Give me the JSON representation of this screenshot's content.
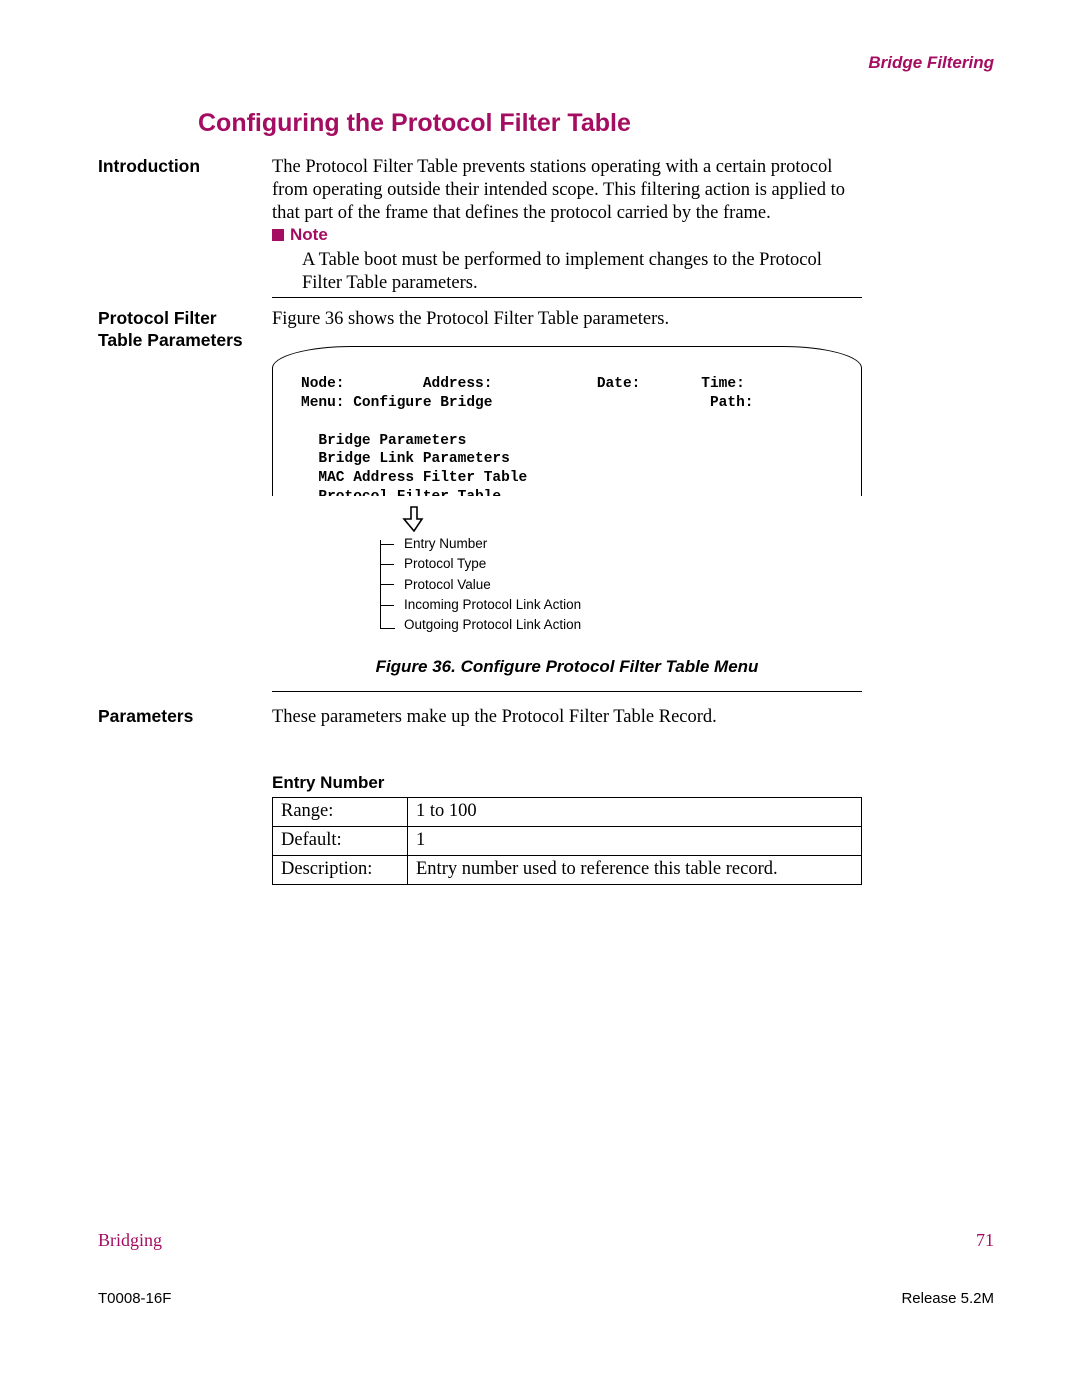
{
  "header": {
    "section": "Bridge Filtering"
  },
  "title": "Configuring the Protocol Filter Table",
  "intro": {
    "label": "Introduction",
    "text": "The Protocol Filter Table prevents stations operating with a certain protocol from operating outside their intended scope. This filtering action is applied to that part of the frame that defines the protocol carried by the frame."
  },
  "note": {
    "heading": "Note",
    "text": "A Table boot must be performed to implement changes to the Protocol Filter Table parameters."
  },
  "params_section": {
    "label": "Protocol Filter Table Parameters",
    "text": "Figure 36 shows the Protocol Filter Table parameters."
  },
  "figure": {
    "menu": {
      "line1": "Node:         Address:            Date:       Time:",
      "line2": "Menu: Configure Bridge                         Path:",
      "items": [
        "Bridge Parameters",
        "Bridge Link Parameters",
        "MAC Address Filter Table",
        "Protocol Filter Table"
      ]
    },
    "subitems": [
      "Entry Number",
      "Protocol Type",
      "Protocol Value",
      "Incoming Protocol Link Action",
      "Outgoing Protocol Link Action"
    ],
    "caption": "Figure 36. Configure Protocol Filter Table Menu"
  },
  "parameters": {
    "label": "Parameters",
    "text": "These parameters make up the Protocol Filter Table Record."
  },
  "entry_table": {
    "heading": "Entry Number",
    "rows": [
      {
        "k": "Range:",
        "v": "1 to 100"
      },
      {
        "k": "Default:",
        "v": "1"
      },
      {
        "k": "Description:",
        "v": "Entry number used to reference this table record."
      }
    ]
  },
  "footer": {
    "left": "Bridging",
    "page": "71",
    "docid": "T0008-16F",
    "release": "Release 5.2M"
  }
}
